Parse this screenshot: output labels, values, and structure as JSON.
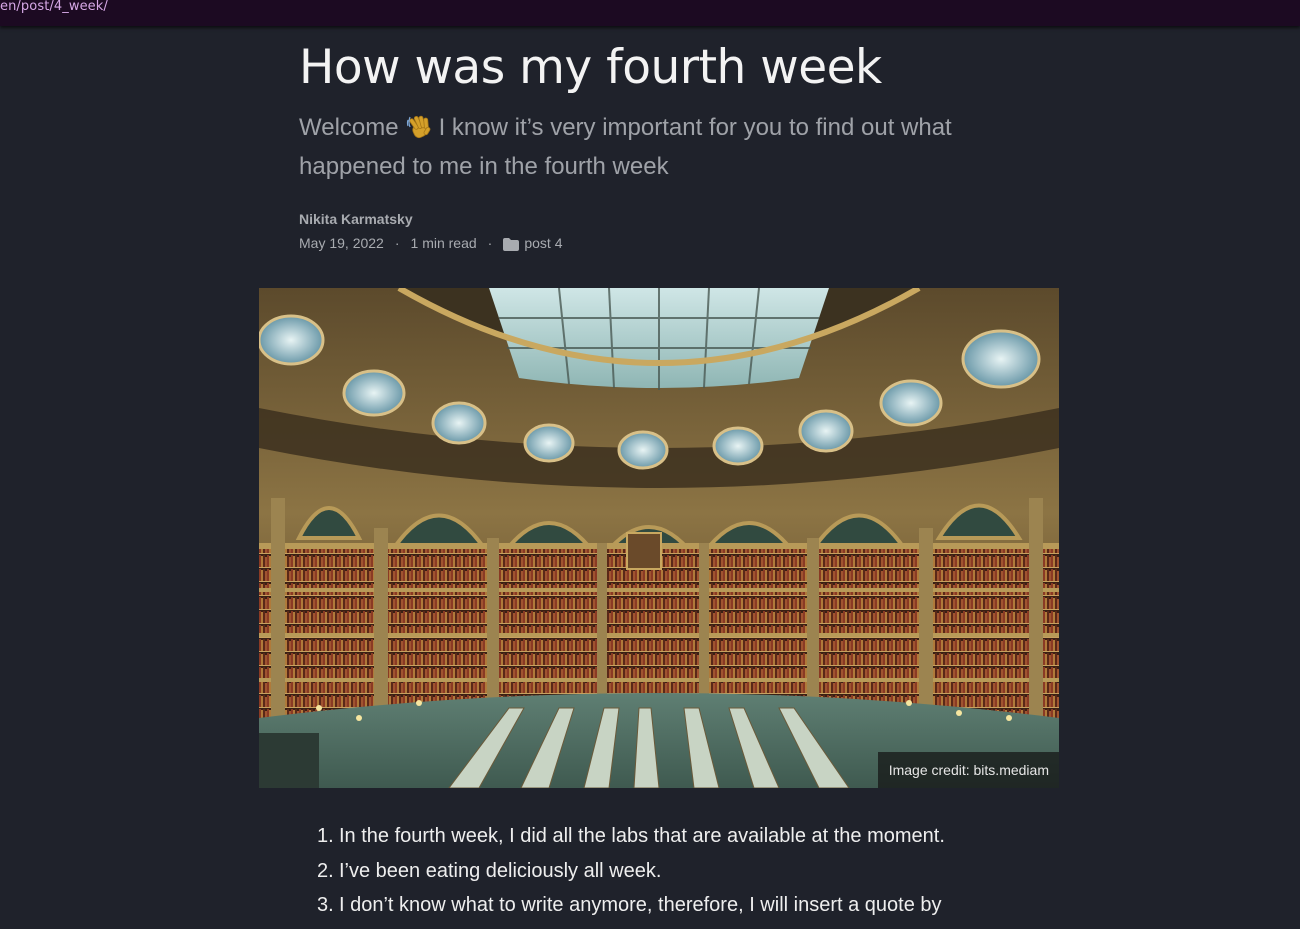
{
  "address_bar": {
    "url": "en/post/4_week/"
  },
  "post": {
    "title": "How was my fourth week",
    "subtitle_before": "Welcome",
    "subtitle_after": "I know it’s very important for you to find out what happened to me in the fourth week",
    "author": "Nikita Karmatsky",
    "date": "May 19, 2022",
    "separator": "·",
    "read_time": "1 min read",
    "category": "post 4",
    "image_credit": "Image credit: bits.mediam"
  },
  "icons": {
    "wave": "waving-hand-icon",
    "folder": "folder-icon"
  },
  "list": [
    {
      "num": "1.",
      "text": "In the fourth week, I did all the labs that are available at the moment."
    },
    {
      "num": "2.",
      "text": "I’ve been eating deliciously all week."
    },
    {
      "num": "3.",
      "text": "I don’t know what to write anymore, therefore, I will insert a quote by"
    }
  ],
  "colors": {
    "background": "#1f222b",
    "top_bar": "#1c0a22",
    "url_text": "#d6a8e6",
    "subtitle": "#9fa2a8",
    "meta": "#a8abb0"
  }
}
